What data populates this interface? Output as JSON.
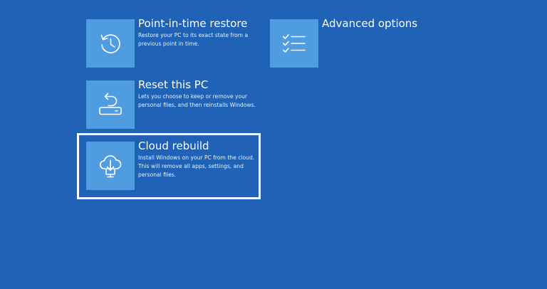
{
  "options": {
    "restore": {
      "title": "Point-in-time restore",
      "description": "Restore your PC to its exact state from a previous point in time.",
      "icon": "clock-restore-icon"
    },
    "advanced": {
      "title": "Advanced options",
      "description": "",
      "icon": "checklist-icon"
    },
    "reset": {
      "title": "Reset this PC",
      "description": "Lets you choose to keep or remove your personal files, and then reinstalls Windows.",
      "icon": "reset-pc-icon"
    },
    "cloud": {
      "title": "Cloud rebuild",
      "description": "Install Windows on your PC from the cloud. This will remove all apps, settings, and personal files.",
      "icon": "cloud-download-icon"
    }
  },
  "colors": {
    "background": "#1f62b6",
    "tile": "#4f9ce0",
    "focus": "#ffffff"
  },
  "focused_option": "cloud"
}
